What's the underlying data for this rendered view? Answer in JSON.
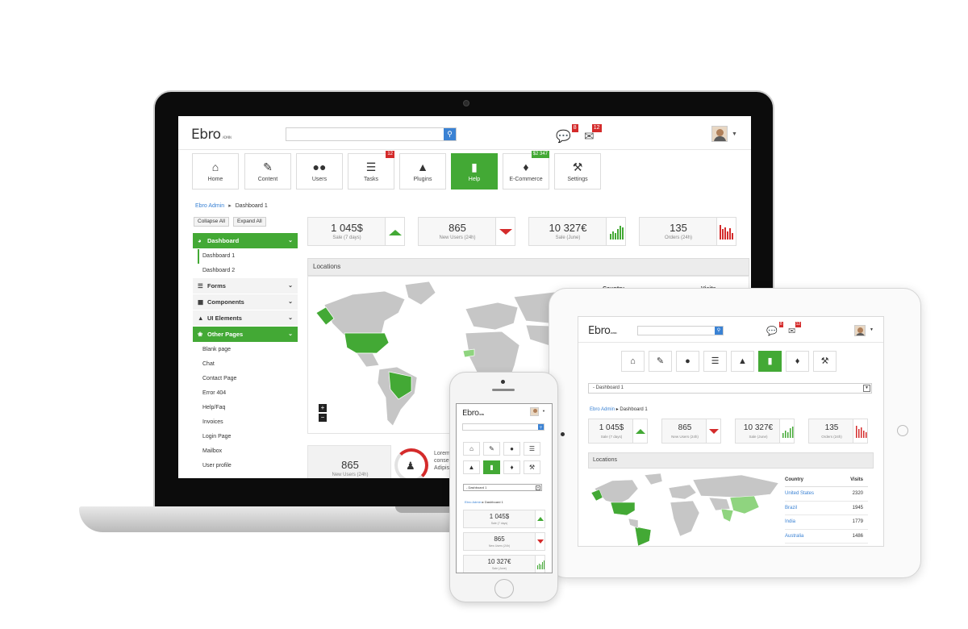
{
  "brand": {
    "logo": "Ebro",
    "logo_sub": "ADMIN",
    "accent": "#43a935",
    "alert": "#d42b2b",
    "link": "#3a82d4"
  },
  "header": {
    "search_placeholder": "",
    "messages_badge": "8",
    "mail_badge": "12",
    "icons": [
      "search-icon",
      "comments-icon",
      "envelope-icon",
      "user-avatar",
      "caret-down-icon"
    ]
  },
  "main_nav": [
    {
      "label": "Home",
      "icon": "home-icon"
    },
    {
      "label": "Content",
      "icon": "edit-icon"
    },
    {
      "label": "Users",
      "icon": "users-icon"
    },
    {
      "label": "Tasks",
      "icon": "tasks-icon",
      "badge": "12"
    },
    {
      "label": "Plugins",
      "icon": "flask-icon"
    },
    {
      "label": "Help",
      "icon": "book-icon",
      "active": true
    },
    {
      "label": "E-Commerce",
      "icon": "tags-icon",
      "badge": "$2 347"
    },
    {
      "label": "Settings",
      "icon": "wrench-icon"
    }
  ],
  "breadcrumb": {
    "root": "Ebro Admin",
    "current": "Dashboard 1"
  },
  "sidebar": {
    "collapse_all": "Collapse All",
    "expand_all": "Expand All",
    "sections": [
      {
        "label": "Dashboard",
        "icon": "dashboard-icon",
        "open": true,
        "items": [
          "Dashboard 1",
          "Dashboard 2"
        ]
      },
      {
        "label": "Forms",
        "icon": "list-icon"
      },
      {
        "label": "Components",
        "icon": "puzzle-icon"
      },
      {
        "label": "UI Elements",
        "icon": "flask-icon"
      },
      {
        "label": "Other Pages",
        "icon": "leaf-icon",
        "open": true,
        "items": [
          "Blank page",
          "Chat",
          "Contact Page",
          "Error 404",
          "Help/Faq",
          "Invoices",
          "Login Page",
          "Mailbox",
          "User profile"
        ]
      }
    ]
  },
  "stats": [
    {
      "value": "1 045$",
      "label": "Sale (7 days)",
      "trend": "up-green"
    },
    {
      "value": "865",
      "label": "New Users (24h)",
      "trend": "down-red"
    },
    {
      "value": "10 327€",
      "label": "Sale (June)",
      "trend": "bars-green"
    },
    {
      "value": "135",
      "label": "Orders (24h)",
      "trend": "bars-red"
    }
  ],
  "locations": {
    "title": "Locations",
    "country_header": "Country",
    "visits_header": "Visits",
    "rows": [
      {
        "country": "United States",
        "visits": "2320"
      },
      {
        "country": "Brazil",
        "visits": "1945"
      },
      {
        "country": "India",
        "visits": "1779"
      },
      {
        "country": "Australia",
        "visits": "1486"
      }
    ],
    "zoom_in": "+",
    "zoom_out": "−"
  },
  "bottom_stat": {
    "value": "865",
    "label": "New Users (24h)",
    "progress": 0.35
  },
  "lorem_lines": [
    "Lorem",
    "conse",
    "Adipis"
  ],
  "tablet": {
    "select_value": "- Dashboard 1"
  },
  "phone": {
    "select_value": "- Dashboard 1"
  }
}
